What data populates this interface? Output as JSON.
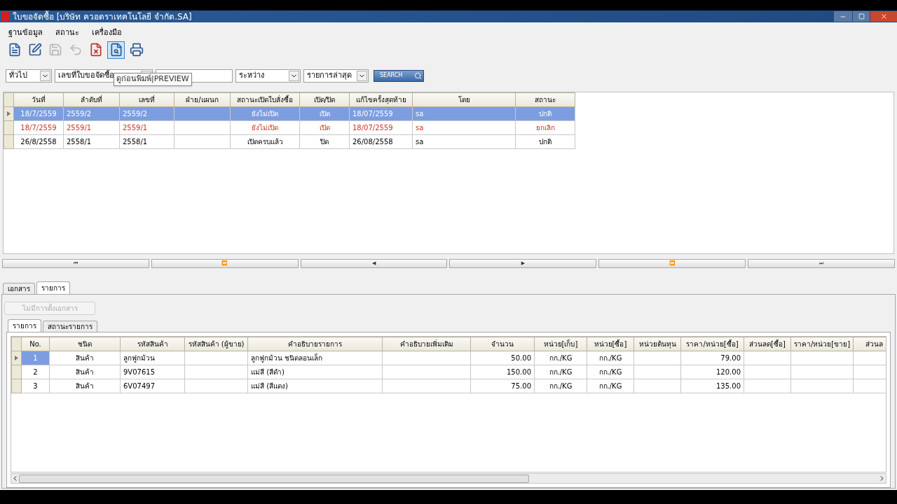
{
  "window": {
    "title": "ใบขอจัดซื้อ [บริษัท  ควอดราเทคโนโลยี  จำกัด.SA]"
  },
  "menu": [
    "ฐานข้อมูล",
    "สถานะ",
    "เครื่องมือ"
  ],
  "toolbar": [
    {
      "kind": "new",
      "disabled": false,
      "selected": false
    },
    {
      "kind": "edit",
      "disabled": false,
      "selected": false
    },
    {
      "kind": "save",
      "disabled": true,
      "selected": false
    },
    {
      "kind": "undo",
      "disabled": true,
      "selected": false
    },
    {
      "kind": "delete",
      "disabled": false,
      "selected": false
    },
    {
      "kind": "preview",
      "disabled": false,
      "selected": true
    },
    {
      "kind": "print",
      "disabled": false,
      "selected": false
    }
  ],
  "tooltip": "ดูก่อนพิมพ์|PREVIEW",
  "filters": {
    "type": "ทั่วไป",
    "field": "เลขที่ใบขอจัดซื้อ",
    "range": "ระหว่าง",
    "order": "รายการล่าสุด",
    "search_button": "SEARCH"
  },
  "orders": {
    "columns": [
      "วันที่",
      "ลำดับที่",
      "เลขที่",
      "ฝ่าย/แผนก",
      "สถานะเปิดใบสั่งซื้อ",
      "เปิด/ปิด",
      "แก้ไขครั้งสุดท้าย",
      "โดย",
      "สถานะ"
    ],
    "rows": [
      {
        "selected": true,
        "kind": "normal",
        "cells": [
          "18/7/2559",
          "2559/2",
          "2559/2",
          "",
          "ยังไม่เปิด",
          "เปิด",
          "18/07/2559",
          "sa",
          "ปกติ"
        ]
      },
      {
        "selected": false,
        "kind": "cancelled",
        "cells": [
          "18/7/2559",
          "2559/1",
          "2559/1",
          "",
          "ยังไม่เปิด",
          "เปิด",
          "18/07/2559",
          "sa",
          "ยกเลิก"
        ]
      },
      {
        "selected": false,
        "kind": "normal",
        "cells": [
          "26/8/2558",
          "2558/1",
          "2558/1",
          "",
          "เปิดครบแล้ว",
          "ปิด",
          "26/08/2558",
          "sa",
          "ปกติ"
        ]
      }
    ]
  },
  "navigation": [
    "⏮",
    "⏪",
    "◀",
    "▶",
    "⏩",
    "⏭"
  ],
  "tabs": [
    {
      "label": "เอกสาร",
      "selected": false
    },
    {
      "label": "รายการ",
      "selected": true
    }
  ],
  "document_button": {
    "label": "ไม่มีการตั้งเอกสาร",
    "disabled": true
  },
  "inner_tabs": [
    {
      "label": "รายการ",
      "selected": true
    },
    {
      "label": "สถานะรายการ",
      "selected": false
    }
  ],
  "items": {
    "columns": [
      "No.",
      "ชนิด",
      "รหัสสินค้า",
      "รหัสสินค้า (ผู้ขาย)",
      "คำอธิบายรายการ",
      "คำอธิบายเพิ่มเติม",
      "จำนวน",
      "หน่วย[เก็บ]",
      "หน่วย[ซื้อ]",
      "หน่วยต้นทุน",
      "ราคา/หน่วย[ซื้อ]",
      "ส่วนลด[ซื้อ]",
      "ราคา/หน่วย[ขาย]",
      "ส่วนล"
    ],
    "rows": [
      {
        "selected": true,
        "cells": [
          "1",
          "สินค้า",
          "ลูกฟูกม้วน",
          "",
          "ลูกฟูกม้วน ชนิดลอนเล็ก",
          "",
          "50.00",
          "กก./KG",
          "กก./KG",
          "",
          "79.00",
          "",
          "",
          ""
        ]
      },
      {
        "selected": false,
        "cells": [
          "2",
          "สินค้า",
          "9V07615",
          "",
          "แม่สี (สีดำ)",
          "",
          "150.00",
          "กก./KG",
          "กก./KG",
          "",
          "120.00",
          "",
          "",
          ""
        ]
      },
      {
        "selected": false,
        "cells": [
          "3",
          "สินค้า",
          "6V07497",
          "",
          "แม่สี (สีแดง)",
          "",
          "75.00",
          "กก./KG",
          "กก./KG",
          "",
          "135.00",
          "",
          "",
          ""
        ]
      }
    ]
  }
}
